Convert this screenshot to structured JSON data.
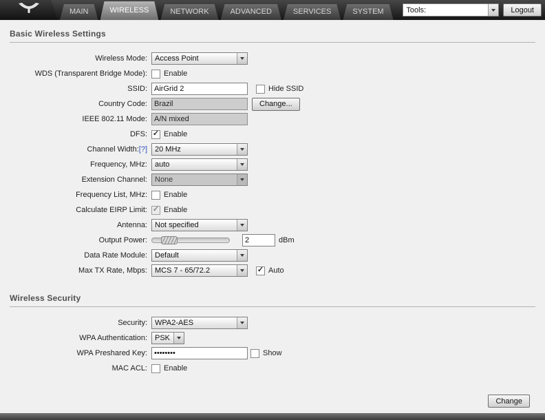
{
  "header": {
    "tabs": [
      {
        "label": "MAIN"
      },
      {
        "label": "WIRELESS"
      },
      {
        "label": "NETWORK"
      },
      {
        "label": "ADVANCED"
      },
      {
        "label": "SERVICES"
      },
      {
        "label": "SYSTEM"
      }
    ],
    "active_tab": "WIRELESS",
    "tools_value": "Tools:",
    "logout_label": "Logout"
  },
  "basic_wireless": {
    "title": "Basic Wireless Settings",
    "wireless_mode": {
      "label": "Wireless Mode:",
      "value": "Access Point"
    },
    "wds": {
      "label": "WDS (Transparent Bridge Mode):",
      "enable_label": "Enable",
      "checked": false
    },
    "ssid": {
      "label": "SSID:",
      "value": "AirGrid 2",
      "hide_ssid_label": "Hide SSID",
      "hide_ssid_checked": false
    },
    "country_code": {
      "label": "Country Code:",
      "value": "Brazil",
      "change_button": "Change..."
    },
    "ieee_mode": {
      "label": "IEEE 802.11 Mode:",
      "value": "A/N mixed"
    },
    "dfs": {
      "label": "DFS:",
      "enable_label": "Enable",
      "checked": true
    },
    "channel_width": {
      "label": "Channel Width:",
      "help_link": "[?]",
      "value": "20 MHz"
    },
    "frequency": {
      "label": "Frequency, MHz:",
      "value": "auto"
    },
    "extension_channel": {
      "label": "Extension Channel:",
      "value": "None",
      "disabled": true
    },
    "frequency_list": {
      "label": "Frequency List, MHz:",
      "enable_label": "Enable",
      "checked": false
    },
    "calculate_eirp": {
      "label": "Calculate EIRP Limit:",
      "enable_label": "Enable",
      "checked": true,
      "disabled": true
    },
    "antenna": {
      "label": "Antenna:",
      "value": "Not specified"
    },
    "output_power": {
      "label": "Output Power:",
      "value": "2",
      "unit": "dBm"
    },
    "data_rate_module": {
      "label": "Data Rate Module:",
      "value": "Default"
    },
    "max_tx_rate": {
      "label": "Max TX Rate, Mbps:",
      "value": "MCS 7 - 65/72.2",
      "auto_label": "Auto",
      "auto_checked": true
    }
  },
  "wireless_security": {
    "title": "Wireless Security",
    "security": {
      "label": "Security:",
      "value": "WPA2-AES"
    },
    "wpa_authentication": {
      "label": "WPA Authentication:",
      "value": "PSK"
    },
    "wpa_preshared_key": {
      "label": "WPA Preshared Key:",
      "value": "••••••••",
      "show_label": "Show",
      "show_checked": false
    },
    "mac_acl": {
      "label": "MAC ACL:",
      "enable_label": "Enable",
      "checked": false
    }
  },
  "footer": {
    "change_button": "Change"
  },
  "colors": {
    "link_blue": "#3355bb",
    "topbar_dark": "#2a2a2a",
    "content_bg": "#f0f0f0"
  }
}
